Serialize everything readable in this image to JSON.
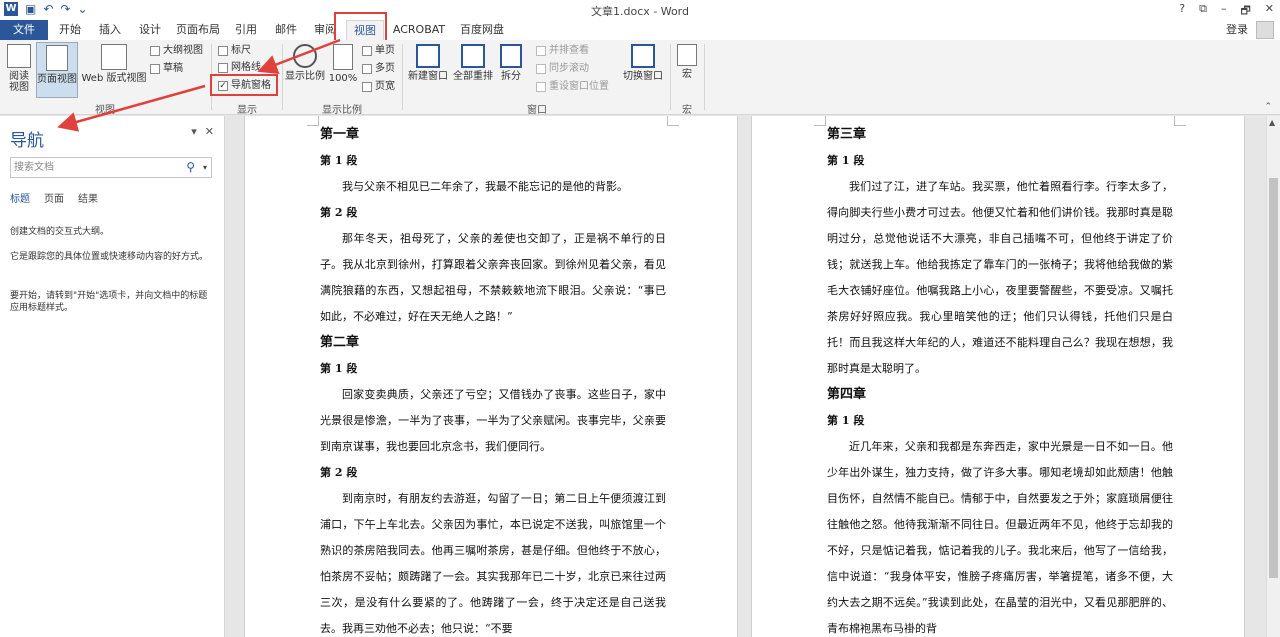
{
  "window": {
    "title": "文章1.docx - Word",
    "controls": [
      "?",
      "⧉",
      "–",
      "🗗",
      "✕"
    ]
  },
  "tabs": [
    {
      "label": "文件"
    },
    {
      "label": "开始"
    },
    {
      "label": "插入"
    },
    {
      "label": "设计"
    },
    {
      "label": "页面布局"
    },
    {
      "label": "引用"
    },
    {
      "label": "邮件"
    },
    {
      "label": "审阅"
    },
    {
      "label": "视图"
    },
    {
      "label": "ACROBAT"
    },
    {
      "label": "百度网盘"
    }
  ],
  "account": {
    "login": "登录"
  },
  "ribbon": {
    "views": {
      "read_mode": "阅读视图",
      "print_layout": "页面视图",
      "web_layout": "Web 版式视图",
      "outline": "大纲视图",
      "draft": "草稿",
      "group": "视图"
    },
    "show": {
      "ruler": "标尺",
      "gridlines": "网格线",
      "nav_pane": "导航窗格",
      "nav_pane_checked": "✓",
      "group": "显示"
    },
    "zoom": {
      "zoom": "显示比例",
      "hundred": "100%",
      "one_page": "单页",
      "multi_page": "多页",
      "page_width": "页宽",
      "group": "显示比例"
    },
    "window": {
      "new_window": "新建窗口",
      "arrange_all": "全部重排",
      "split": "拆分",
      "side_by_side": "并排查看",
      "sync_scroll": "同步滚动",
      "reset_position": "重设窗口位置",
      "switch_windows": "切换窗口",
      "group": "窗口"
    },
    "macros": {
      "macros": "宏",
      "group": "宏"
    }
  },
  "nav": {
    "title": "导航",
    "search_placeholder": "搜索文档",
    "tabs": [
      "标题",
      "页面",
      "结果"
    ],
    "msg1": "创建文档的交互式大纲。",
    "msg2": "它是跟踪您的具体位置或快速移动内容的好方式。",
    "msg3": "要开始，请转到\"开始\"选项卡，并向文档中的标题应用标题样式。"
  },
  "page1": {
    "ch1": "第一章",
    "s1": "第 1 段",
    "p1": "我与父亲不相见已二年余了，我最不能忘记的是他的背影。",
    "s2": "第 2 段",
    "p2": "那年冬天，祖母死了，父亲的差使也交卸了，正是祸不单行的日子。我从北京到徐州，打算跟着父亲奔丧回家。到徐州见着父亲，看见满院狼藉的东西，又想起祖母，不禁簌簌地流下眼泪。父亲说：“事已如此，不必难过，好在天无绝人之路！”",
    "ch2": "第二章",
    "s3": "第 1 段",
    "p3": "回家变卖典质，父亲还了亏空；又借钱办了丧事。这些日子，家中光景很是惨澹，一半为了丧事，一半为了父亲赋闲。丧事完毕，父亲要到南京谋事，我也要回北京念书，我们便同行。",
    "s4": "第 2 段",
    "p4": "到南京时，有朋友约去游逛，勾留了一日；第二日上午便须渡江到浦口，下午上车北去。父亲因为事忙，本已说定不送我，叫旅馆里一个熟识的茶房陪我同去。他再三嘱咐茶房，甚是仔细。但他终于不放心，怕茶房不妥帖；颇踌躇了一会。其实我那年已二十岁，北京已来往过两三次，是没有什么要紧的了。他踌躇了一会，终于决定还是自己送我去。我再三劝他不必去；他只说：“不要"
  },
  "page2": {
    "ch3": "第三章",
    "s1": "第 1 段",
    "p1": "我们过了江，进了车站。我买票，他忙着照看行李。行李太多了，得向脚夫行些小费才可过去。他便又忙着和他们讲价钱。我那时真是聪明过分，总觉他说话不大漂亮，非自己插嘴不可，但他终于讲定了价钱；就送我上车。他给我拣定了靠车门的一张椅子；我将他给我做的紫毛大衣铺好座位。他嘱我路上小心，夜里要警醒些，不要受凉。又嘱托茶房好好照应我。我心里暗笑他的迂；他们只认得钱，托他们只是白托！而且我这样大年纪的人，难道还不能料理自己么？我现在想想，我那时真是太聪明了。",
    "ch4": "第四章",
    "s2": "第 1 段",
    "p2": "近几年来，父亲和我都是东奔西走，家中光景是一日不如一日。他少年出外谋生，独力支持，做了许多大事。哪知老境却如此颓唐！他触目伤怀，自然情不能自已。情郁于中，自然要发之于外；家庭琐屑便往往触他之怒。他待我渐渐不同往日。但最近两年不见，他终于忘却我的不好，只是惦记着我，惦记着我的儿子。我北来后，他写了一信给我，信中说道：“我身体平安，惟膀子疼痛厉害，举箸提笔，诸多不便，大约大去之期不远矣。”我读到此处，在晶莹的泪光中，又看见那肥胖的、青布棉袍黑布马褂的背"
  },
  "colors": {
    "accent": "#2b579a",
    "annotation": "#e0413c"
  }
}
